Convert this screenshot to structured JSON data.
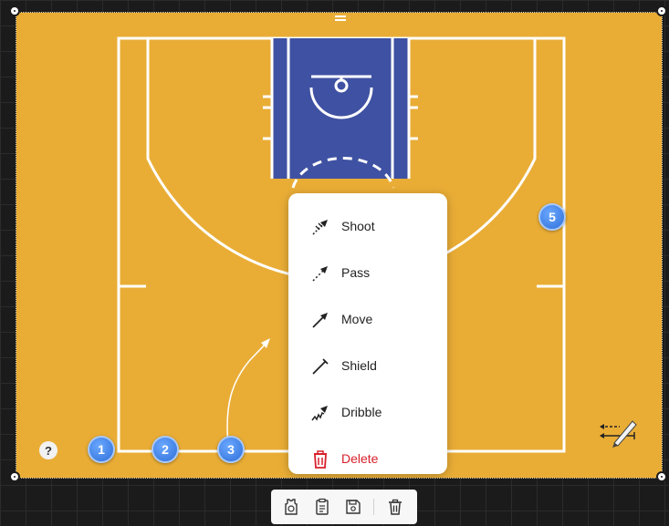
{
  "board": {
    "background": "#e9ad36",
    "paint_color": "#3f51a2",
    "line_color": "#ffffff",
    "drag_handle_icon": "hamburger-icon"
  },
  "players": [
    {
      "label": "1"
    },
    {
      "label": "2"
    },
    {
      "label": "3"
    },
    {
      "label": "5"
    }
  ],
  "help": {
    "label": "?"
  },
  "context_menu": {
    "items": [
      {
        "label": "Shoot",
        "icon": "shoot-arrow-icon"
      },
      {
        "label": "Pass",
        "icon": "pass-arrow-icon"
      },
      {
        "label": "Move",
        "icon": "move-arrow-icon"
      },
      {
        "label": "Shield",
        "icon": "shield-line-icon"
      },
      {
        "label": "Dribble",
        "icon": "dribble-arrow-icon"
      },
      {
        "label": "Delete",
        "icon": "trash-icon",
        "color": "#d8202a"
      }
    ]
  },
  "toolbar": {
    "buttons": [
      "jersey-icon",
      "notes-icon",
      "save-icon",
      "trash-icon"
    ]
  },
  "pen_tool": {
    "icon": "pen-arrows-icon"
  }
}
